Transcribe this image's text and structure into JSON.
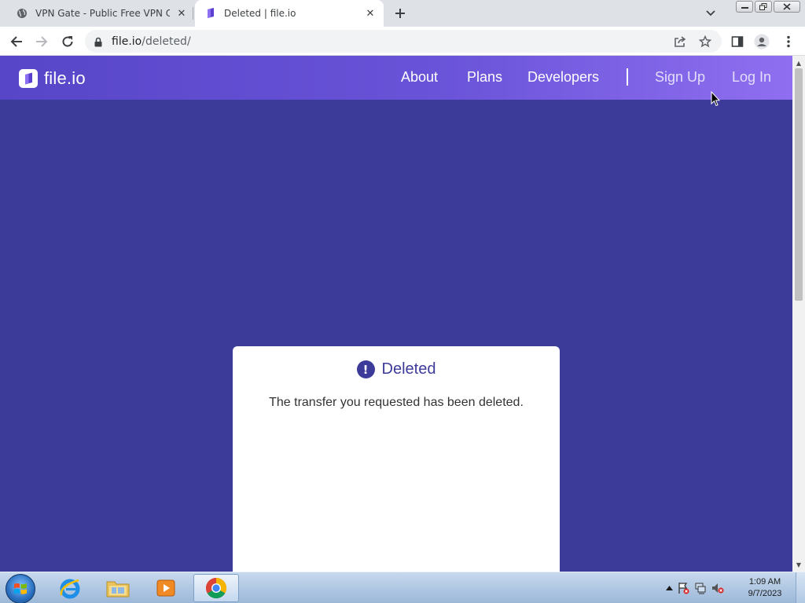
{
  "browser": {
    "tabs": [
      {
        "title": "VPN Gate - Public Free VPN Clou",
        "active": false
      },
      {
        "title": "Deleted | file.io",
        "active": true
      }
    ],
    "url_host": "file.io",
    "url_path": "/deleted/"
  },
  "site": {
    "logo_text": "file.io",
    "nav": {
      "about": "About",
      "plans": "Plans",
      "developers": "Developers",
      "signup": "Sign Up",
      "login": "Log In"
    },
    "card": {
      "icon_glyph": "!",
      "title": "Deleted",
      "message": "The transfer you requested has been deleted."
    }
  },
  "taskbar": {
    "time": "1:09 AM",
    "date": "9/7/2023"
  },
  "colors": {
    "page_bg": "#3d3b9a",
    "header_start": "#5746c8",
    "header_end": "#8f6ff0",
    "card_bg": "#ffffff",
    "accent": "#3d3b9a"
  }
}
